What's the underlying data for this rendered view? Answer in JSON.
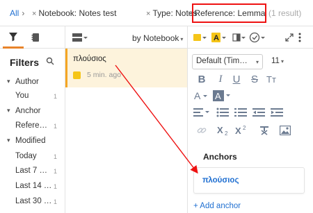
{
  "breadcrumb": {
    "all_label": "All",
    "chevron": "›",
    "close_glyph": "×",
    "notebook": "Notebook: Notes test",
    "type": "Type: Notes",
    "reference": "Reference: Lemma",
    "result_count": "(1 result)"
  },
  "filters": {
    "title": "Filters",
    "groups": [
      {
        "label": "Author",
        "expanded": true
      },
      {
        "label": "You",
        "count": "1"
      },
      {
        "label": "Anchor",
        "expanded": true
      },
      {
        "label": "Refere…",
        "count": "1"
      },
      {
        "label": "Modified",
        "expanded": true
      },
      {
        "label": "Today",
        "count": "1"
      },
      {
        "label": "Last 7 …",
        "count": "1"
      },
      {
        "label": "Last 14 …",
        "count": "1"
      },
      {
        "label": "Last 30 …",
        "count": "1"
      }
    ]
  },
  "notes": {
    "sort_label": "by Notebook",
    "items": [
      {
        "title": "πλούσιος",
        "time": "5 min. ago"
      }
    ]
  },
  "editor": {
    "font_family": "Default (Tim…",
    "font_size": "11",
    "format_row1": [
      "B",
      "I",
      "U",
      "S",
      "Tт"
    ],
    "anchors_title": "Anchors",
    "anchor_link": "πλούσιος",
    "add_anchor": "+ Add anchor"
  },
  "colors": {
    "accent": "#e8832a",
    "link": "#1f6fd1",
    "selected_bg": "#fdf3dc",
    "highlight_box": "#ee1111",
    "note_icon": "#f5c518"
  }
}
